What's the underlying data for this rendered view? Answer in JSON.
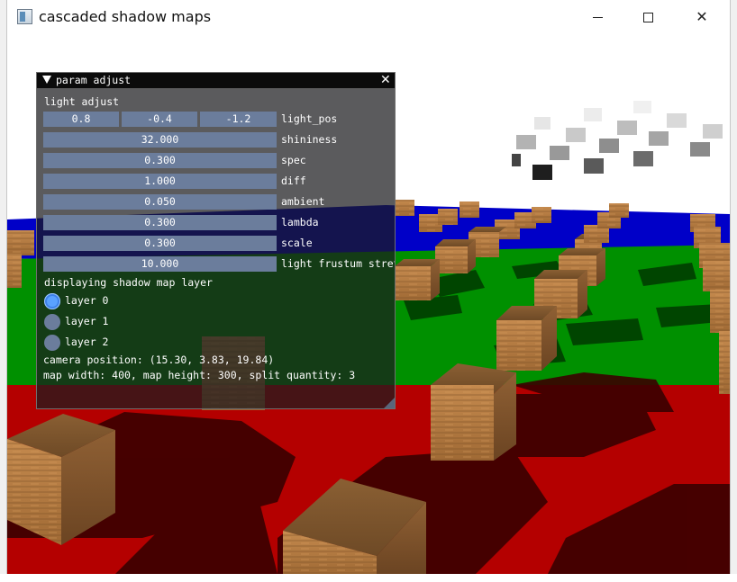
{
  "window": {
    "title": "cascaded shadow maps",
    "minimize_icon": "minimize-icon",
    "maximize_icon": "maximize-icon",
    "close_icon": "close-icon"
  },
  "panel": {
    "title": "param adjust",
    "close_glyph": "✕",
    "section_light": "light adjust",
    "light_pos": {
      "x": "0.8",
      "y": "-0.4",
      "z": "-1.2",
      "label": "light_pos"
    },
    "sliders": [
      {
        "value": "32.000",
        "label": "shininess"
      },
      {
        "value": "0.300",
        "label": "spec"
      },
      {
        "value": "1.000",
        "label": "diff"
      },
      {
        "value": "0.050",
        "label": "ambient"
      },
      {
        "value": "0.300",
        "label": "lambda"
      },
      {
        "value": "0.300",
        "label": "scale"
      },
      {
        "value": "10.000",
        "label": "light frustum stretch"
      }
    ],
    "section_layer": "displaying shadow map layer",
    "layers": [
      {
        "label": "layer 0",
        "selected": true
      },
      {
        "label": "layer 1",
        "selected": false
      },
      {
        "label": "layer 2",
        "selected": false
      }
    ],
    "camera_position": "camera position: (15.30, 3.83, 19.84)",
    "map_info": "map width: 400, map height: 300, split quantity: 3"
  },
  "scene": {
    "colors": {
      "sky": "#ffffff",
      "blue_floor": "#0000c8",
      "green_floor": "#008c00",
      "red_floor": "#b40000",
      "crate": "#a9743f",
      "shadow": "#3a0000"
    }
  }
}
